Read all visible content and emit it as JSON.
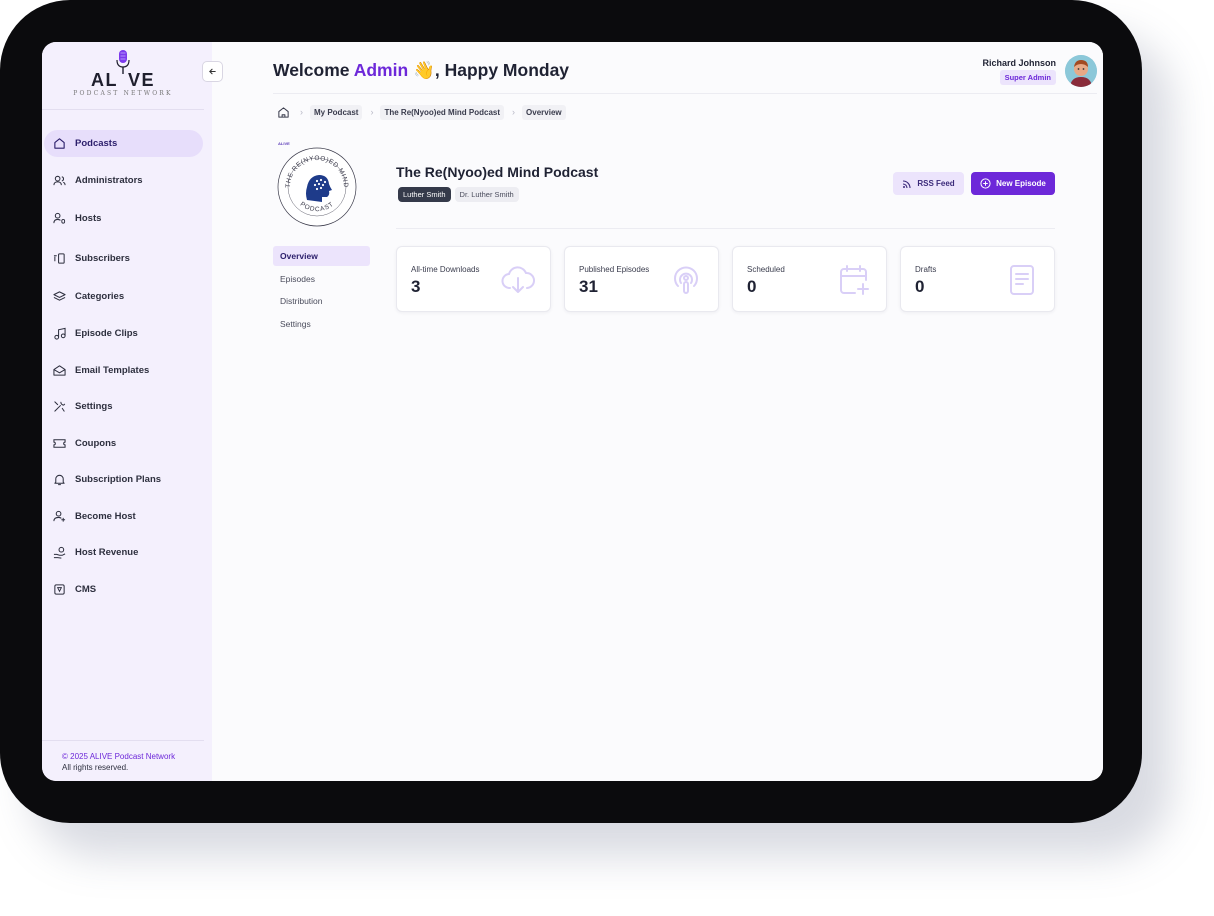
{
  "brand": {
    "name_a": "AL",
    "name_b": "VE",
    "subtitle": "PODCAST NETWORK"
  },
  "sidebar": {
    "items": [
      {
        "label": "Podcasts",
        "icon": "home-icon",
        "active": true
      },
      {
        "label": "Administrators",
        "icon": "users-icon"
      },
      {
        "label": "Hosts",
        "icon": "user-mic-icon"
      },
      {
        "label": "Subscribers",
        "icon": "subscriber-icon"
      },
      {
        "label": "Categories",
        "icon": "layers-icon"
      },
      {
        "label": "Episode Clips",
        "icon": "music-note-icon"
      },
      {
        "label": "Email Templates",
        "icon": "mail-icon"
      },
      {
        "label": "Settings",
        "icon": "tools-icon"
      },
      {
        "label": "Coupons",
        "icon": "ticket-icon"
      },
      {
        "label": "Subscription Plans",
        "icon": "bell-icon"
      },
      {
        "label": "Become Host",
        "icon": "user-plus-icon"
      },
      {
        "label": "Host Revenue",
        "icon": "hand-coins-icon"
      },
      {
        "label": "CMS",
        "icon": "cms-icon"
      }
    ],
    "footer_copyright": "© 2025 ALIVE Podcast Network",
    "footer_rights": "All rights reserved."
  },
  "header": {
    "welcome_prefix": "Welcome",
    "welcome_name": "Admin",
    "welcome_emoji": "👋",
    "welcome_suffix": ", Happy Monday",
    "user_name": "Richard Johnson",
    "user_role": "Super Admin"
  },
  "breadcrumb": {
    "items": [
      "My Podcast",
      "The Re(Nyoo)ed Mind Podcast",
      "Overview"
    ]
  },
  "podcast": {
    "title": "The Re(Nyoo)ed Mind Podcast",
    "cover_text_top": "THE RE(NYOO)ED MIND",
    "cover_text_bottom": "PODCAST",
    "cover_brand": "ALIVE",
    "tags": [
      "Luther Smith",
      "Dr. Luther Smith"
    ]
  },
  "actions": {
    "rss_label": "RSS Feed",
    "new_episode_label": "New Episode"
  },
  "sub_nav": {
    "items": [
      "Overview",
      "Episodes",
      "Distribution",
      "Settings"
    ]
  },
  "stats": [
    {
      "label": "All-time Downloads",
      "value": "3",
      "icon": "cloud-download-icon"
    },
    {
      "label": "Published Episodes",
      "value": "31",
      "icon": "podcast-icon"
    },
    {
      "label": "Scheduled",
      "value": "0",
      "icon": "calendar-plus-icon"
    },
    {
      "label": "Drafts",
      "value": "0",
      "icon": "document-icon"
    }
  ],
  "colors": {
    "accent": "#6d28d9",
    "sidebar_bg": "#f4f0fd",
    "active_bg": "#e7defb"
  }
}
